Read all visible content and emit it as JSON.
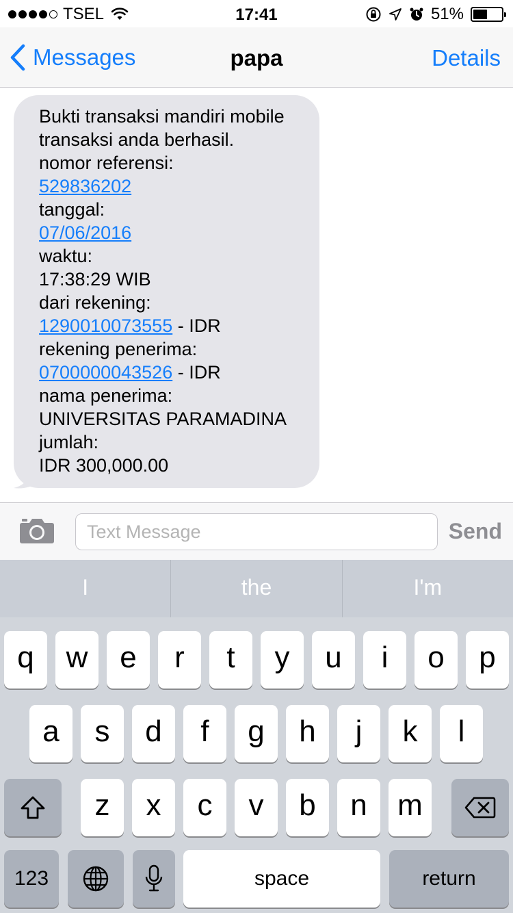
{
  "status": {
    "carrier": "TSEL",
    "time": "17:41",
    "battery_percent": "51%",
    "battery_level": 0.51,
    "signal_bars": 4
  },
  "nav": {
    "back_label": "Messages",
    "title": "papa",
    "details_label": "Details"
  },
  "message": {
    "lines": [
      {
        "text": "Bukti transaksi mandiri mobile",
        "link": "",
        "suffix": ""
      },
      {
        "text": "transaksi anda berhasil.",
        "link": "",
        "suffix": ""
      },
      {
        "text": "nomor referensi:",
        "link": "",
        "suffix": ""
      },
      {
        "text": "",
        "link": "529836202",
        "suffix": ""
      },
      {
        "text": "tanggal:",
        "link": "",
        "suffix": ""
      },
      {
        "text": "",
        "link": "07/06/2016",
        "suffix": ""
      },
      {
        "text": "waktu:",
        "link": "",
        "suffix": ""
      },
      {
        "text": "17:38:29 WIB",
        "link": "",
        "suffix": ""
      },
      {
        "text": "dari rekening:",
        "link": "",
        "suffix": ""
      },
      {
        "text": "",
        "link": "1290010073555",
        "suffix": " - IDR"
      },
      {
        "text": "rekening penerima:",
        "link": "",
        "suffix": ""
      },
      {
        "text": "",
        "link": "0700000043526",
        "suffix": " - IDR"
      },
      {
        "text": "nama penerima:",
        "link": "",
        "suffix": ""
      },
      {
        "text": "UNIVERSITAS PARAMADINA",
        "link": "",
        "suffix": ""
      },
      {
        "text": "jumlah:",
        "link": "",
        "suffix": ""
      },
      {
        "text": "IDR 300,000.00",
        "link": "",
        "suffix": ""
      }
    ]
  },
  "compose": {
    "placeholder": "Text Message",
    "value": "",
    "send_label": "Send"
  },
  "keyboard": {
    "suggestions": [
      "I",
      "the",
      "I'm"
    ],
    "row1": [
      "q",
      "w",
      "e",
      "r",
      "t",
      "y",
      "u",
      "i",
      "o",
      "p"
    ],
    "row2": [
      "a",
      "s",
      "d",
      "f",
      "g",
      "h",
      "j",
      "k",
      "l"
    ],
    "row3": [
      "z",
      "x",
      "c",
      "v",
      "b",
      "n",
      "m"
    ],
    "numbers_label": "123",
    "space_label": "space",
    "return_label": "return"
  },
  "colors": {
    "accent": "#157efb",
    "bubble": "#e5e5ea",
    "keyboard_bg": "#d1d5db"
  },
  "icons": {
    "back": "chevron-left-icon",
    "camera": "camera-icon",
    "shift": "shift-icon",
    "delete": "delete-icon",
    "globe": "globe-icon",
    "mic": "microphone-icon",
    "wifi": "wifi-icon",
    "alarm": "alarm-icon",
    "location": "location-icon",
    "lock": "orientation-lock-icon"
  }
}
